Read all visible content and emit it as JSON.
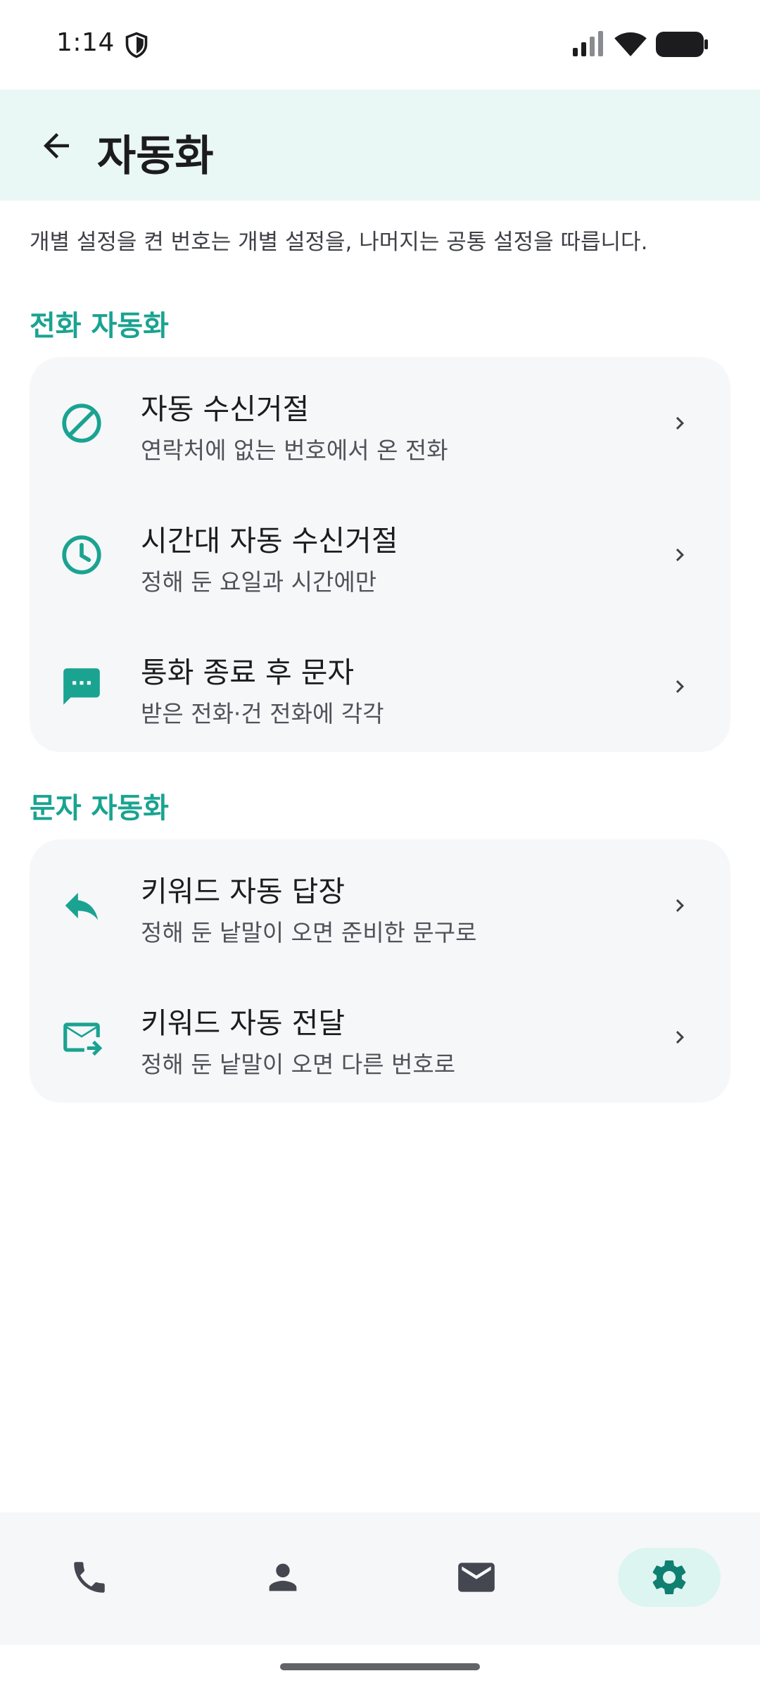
{
  "status_bar": {
    "time": "1:14"
  },
  "app_bar": {
    "title": "자동화"
  },
  "description": "개별 설정을 켠 번호는 개별 설정을, 나머지는 공통 설정을 따릅니다.",
  "sections": [
    {
      "title": "전화 자동화",
      "items": [
        {
          "title": "자동 수신거절",
          "subtitle": "연락처에 없는 번호에서 온 전화",
          "icon": "block-icon"
        },
        {
          "title": "시간대 자동 수신거절",
          "subtitle": "정해 둔 요일과 시간에만",
          "icon": "clock-icon"
        },
        {
          "title": "통화 종료 후 문자",
          "subtitle": "받은 전화·건 전화에 각각",
          "icon": "sms-icon"
        }
      ]
    },
    {
      "title": "문자 자동화",
      "items": [
        {
          "title": "키워드 자동 답장",
          "subtitle": "정해 둔 낱말이 오면 준비한 문구로",
          "icon": "reply-icon"
        },
        {
          "title": "키워드 자동 전달",
          "subtitle": "정해 둔 낱말이 오면 다른 번호로",
          "icon": "forward-mail-icon"
        }
      ]
    }
  ],
  "bottom_nav": {
    "items": [
      "phone-icon",
      "contacts-icon",
      "messages-icon",
      "settings-icon"
    ],
    "active": "settings-icon"
  },
  "colors": {
    "accent": "#1aa391",
    "app_bar_bg": "#eaf8f5",
    "card_bg": "#f6f7f9",
    "active_nav_bg": "#ddf5f0",
    "nav_icon": "#44474f"
  }
}
